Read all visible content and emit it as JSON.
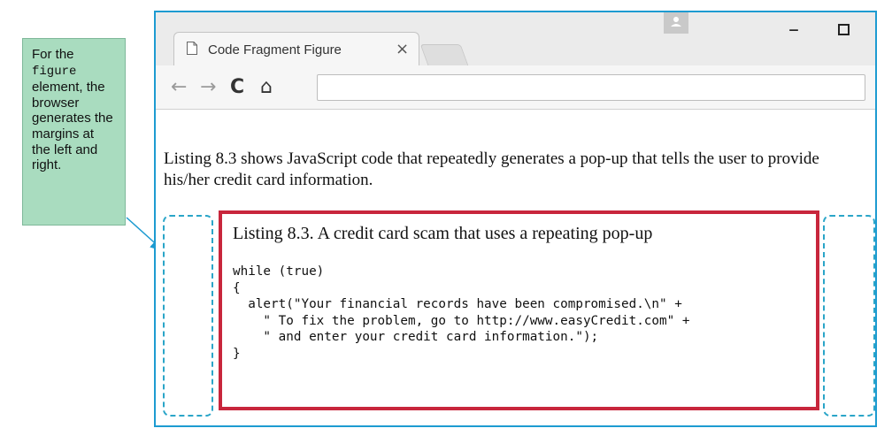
{
  "callout": {
    "line1": "For the",
    "code": "figure",
    "line3": "element, the browser generates the margins at the left and right."
  },
  "browser": {
    "tab_title": "Code Fragment Figure",
    "tab_close": "×",
    "window_controls": {
      "minimize": "–",
      "close": "✕"
    },
    "toolbar": {
      "back": "←",
      "forward": "→",
      "reload": "C",
      "home": "⌂"
    },
    "address": ""
  },
  "content": {
    "intro": "Listing 8.3 shows JavaScript code that repeatedly generates a pop-up that tells the user to provide his/her credit card information.",
    "figure": {
      "caption": "Listing 8.3. A credit card scam that uses a repeating pop-up",
      "code": "while (true)\n{\n  alert(\"Your financial records have been compromised.\\n\" +\n    \" To fix the problem, go to http://www.easyCredit.com\" +\n    \" and enter your credit card information.\");\n}"
    }
  },
  "colors": {
    "callout_bg": "#a9dcbf",
    "window_border": "#1d9bd1",
    "figure_border": "#c8263c",
    "margin_dash": "#2aa5c8"
  }
}
